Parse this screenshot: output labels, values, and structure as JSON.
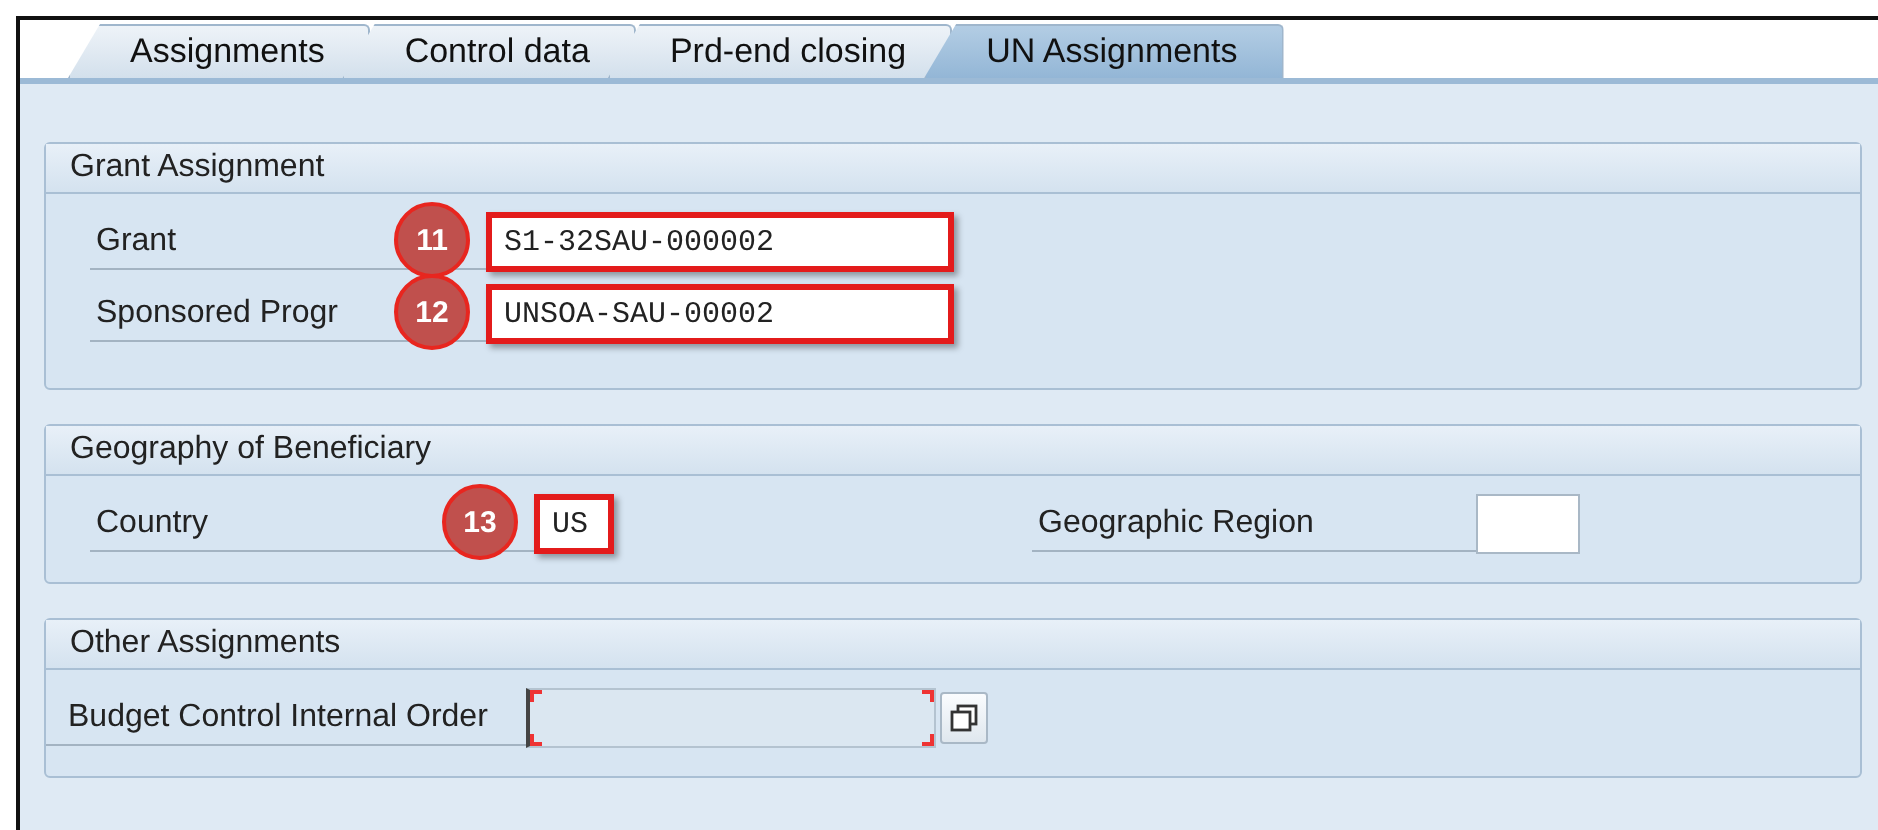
{
  "tabs": [
    {
      "label": "Assignments",
      "selected": false
    },
    {
      "label": "Control data",
      "selected": false
    },
    {
      "label": "Prd-end closing",
      "selected": false
    },
    {
      "label": "UN Assignments",
      "selected": true
    }
  ],
  "sections": [
    {
      "title": "Grant Assignment",
      "rows": [
        {
          "fields": [
            {
              "kind": "text",
              "label": "Grant",
              "marker": "11",
              "value": "S1-32SAU-000002",
              "highlighted": true
            }
          ]
        },
        {
          "fields": [
            {
              "kind": "text",
              "label": "Sponsored Progr",
              "marker": "12",
              "value": "UNSOA-SAU-00002",
              "highlighted": true
            }
          ]
        }
      ]
    },
    {
      "title": "Geography of Beneficiary",
      "rows": [
        {
          "fields": [
            {
              "kind": "short",
              "label": "Country",
              "marker": "13",
              "value": "US",
              "highlighted": true
            },
            {
              "kind": "short",
              "label": "Geographic Region",
              "highlighted": false
            }
          ]
        }
      ]
    },
    {
      "title": "Other Assignments",
      "rows": [
        {
          "fields": [
            {
              "kind": "required",
              "label": "Budget Control Internal Order",
              "highlighted": false
            }
          ]
        }
      ]
    }
  ]
}
